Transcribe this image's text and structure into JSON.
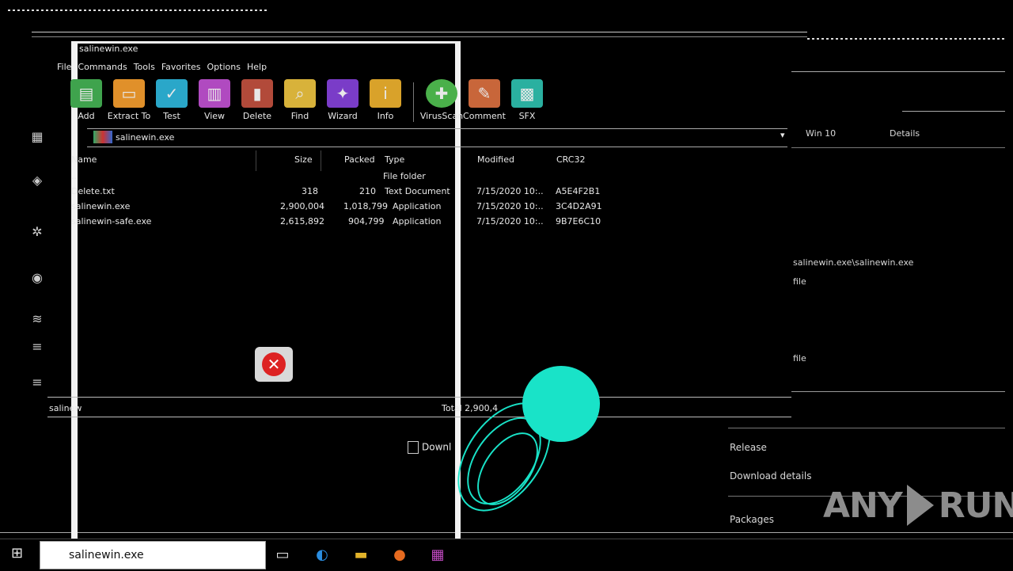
{
  "window": {
    "title": "salinewin.exe",
    "menu": [
      "File",
      "Commands",
      "Tools",
      "Favorites",
      "Options",
      "Help"
    ]
  },
  "toolbar": [
    {
      "label": "Add",
      "icon": "add-archive-icon",
      "color": "#3fa34d"
    },
    {
      "label": "Extract To",
      "icon": "extract-folder-icon",
      "color": "#e0902a"
    },
    {
      "label": "Test",
      "icon": "test-clipboard-icon",
      "color": "#2aa7c9"
    },
    {
      "label": "View",
      "icon": "view-book-icon",
      "color": "#b04ac0"
    },
    {
      "label": "Delete",
      "icon": "delete-books-icon",
      "color": "#b24a3a"
    },
    {
      "label": "Find",
      "icon": "find-magnifier-icon",
      "color": "#d8b23a"
    },
    {
      "label": "Wizard",
      "icon": "wizard-wand-icon",
      "color": "#7a3cc8"
    },
    {
      "label": "Info",
      "icon": "info-icon",
      "color": "#d9a22a"
    },
    {
      "label": "VirusScan",
      "icon": "virus-scan-icon",
      "color": "#4ab04a"
    },
    {
      "label": "Comment",
      "icon": "comment-icon",
      "color": "#c8663a"
    },
    {
      "label": "SFX",
      "icon": "sfx-icon",
      "color": "#2ab0a0"
    }
  ],
  "address": {
    "path": "salinewin.exe"
  },
  "columns": {
    "name": "Name",
    "size": "Size",
    "packed": "Packed",
    "type": "Type",
    "modified": "Modified",
    "crc": "CRC32"
  },
  "files": [
    {
      "name": "..",
      "size": "",
      "packed": "",
      "type": "File folder",
      "modified": "",
      "crc": ""
    },
    {
      "name": "Delete.txt",
      "size": "318",
      "packed": "210",
      "type": "Text Document",
      "modified": "7/15/2020 10:..",
      "crc": "A5E4F2B1"
    },
    {
      "name": "salinewin.exe",
      "size": "2,900,004",
      "packed": "1,018,799",
      "type": "Application",
      "modified": "7/15/2020 10:..",
      "crc": "3C4D2A91"
    },
    {
      "name": "salinewin-safe.exe",
      "size": "2,615,892",
      "packed": "904,799",
      "type": "Application",
      "modified": "7/15/2020 10:..",
      "crc": "9B7E6C10"
    }
  ],
  "status": {
    "left": "salinew",
    "right": "Total 2,900,4"
  },
  "right_panel": {
    "line1": "salinewin.exe\\salinewin.exe",
    "line2": "file",
    "line3": "file",
    "item1": "Release",
    "item2": "Download details",
    "item3": "Packages",
    "tab1": "Win 10",
    "tab2": "Details"
  },
  "download": {
    "label": "Downl"
  },
  "taskbar": {
    "search_query": "salinewin.exe",
    "icons": [
      "task-view-icon",
      "edge-browser-icon",
      "file-explorer-icon",
      "firefox-icon",
      "winrar-icon"
    ]
  },
  "watermark": {
    "text_left": "ANY",
    "text_right": "RUN"
  },
  "colors": {
    "accent": "#19e3c8",
    "error": "#d22222"
  }
}
